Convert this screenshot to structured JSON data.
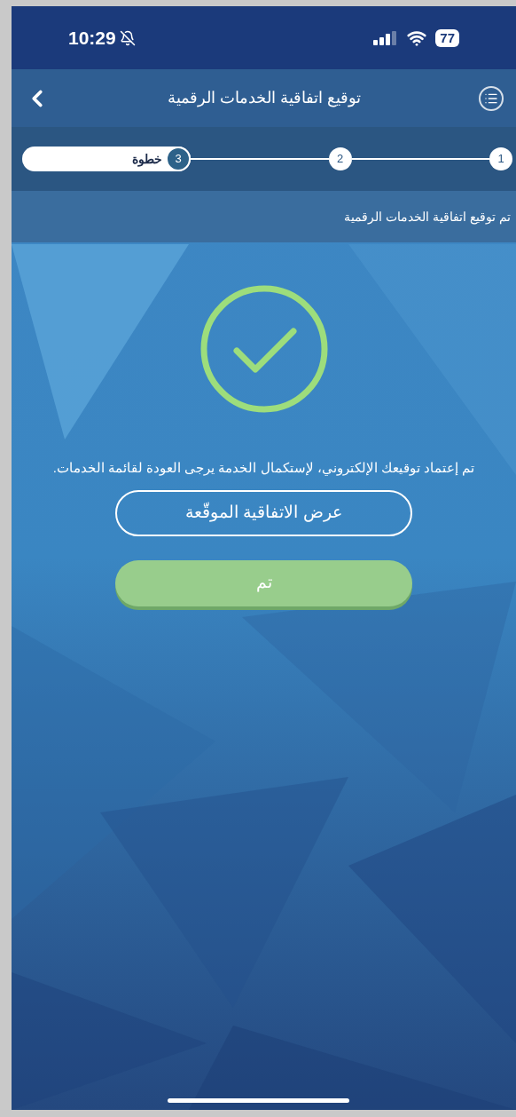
{
  "status_bar": {
    "time": "10:29",
    "battery": "77"
  },
  "header": {
    "title": "توقيع اتفاقية الخدمات الرقمية"
  },
  "steps": [
    {
      "number": "1",
      "selected": false
    },
    {
      "number": "2",
      "selected": false
    },
    {
      "number": "3",
      "label": "خطوة",
      "selected": true
    }
  ],
  "subtitle": "تم توقيع اتفاقية الخدمات الرقمية",
  "message": "تم إعتماد توقيعك الإلكتروني، لإستكمال الخدمة يرجى العودة لقائمة الخدمات.",
  "buttons": [
    {
      "kind": "outline",
      "label": "عرض الاتفاقية الموقّعة"
    },
    {
      "kind": "filled",
      "label": "تم"
    }
  ]
}
